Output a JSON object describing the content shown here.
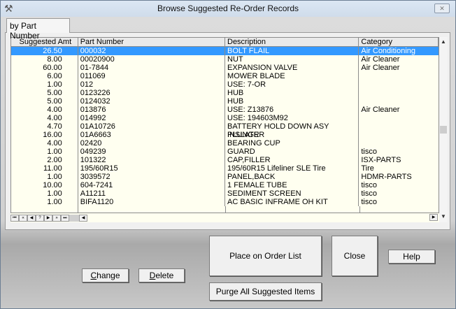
{
  "window": {
    "title": "Browse Suggested Re-Order Records",
    "close_glyph": "✕",
    "app_icon": "tools-icon"
  },
  "tab": {
    "label": "by Part Number"
  },
  "table": {
    "headers": [
      "Suggested Amt",
      "Part Number",
      "Description",
      "Category"
    ],
    "selected_index": 0,
    "rows": [
      [
        "26.50",
        "000032",
        "BOLT FLAIL",
        "Air Conditioning"
      ],
      [
        "8.00",
        "00020900",
        "NUT",
        "Air Cleaner"
      ],
      [
        "60.00",
        "01-7844",
        "EXPANSION VALVE",
        "Air Cleaner"
      ],
      [
        "6.00",
        "011069",
        "MOWER BLADE",
        ""
      ],
      [
        "1.00",
        "012",
        "USE: 7-OR",
        ""
      ],
      [
        "5.00",
        "0123226",
        "HUB",
        ""
      ],
      [
        "5.00",
        "0124032",
        "HUB",
        ""
      ],
      [
        "4.00",
        "013876",
        "USE: Z13876",
        "Air Cleaner"
      ],
      [
        "4.00",
        "014992",
        "USE: 194603M92",
        ""
      ],
      [
        "4.70",
        "01A10726",
        "BATTERY HOLD DOWN ASY INSLATR",
        ""
      ],
      [
        "16.00",
        "01A6663",
        "PLUNGER",
        ""
      ],
      [
        "4.00",
        "02420",
        "BEARING CUP",
        ""
      ],
      [
        "1.00",
        "049239",
        "GUARD",
        "tisco"
      ],
      [
        "2.00",
        "101322",
        "CAP,FILLER",
        "ISX-PARTS"
      ],
      [
        "11.00",
        "195/60R15",
        "195/60R15 Lifeliner SLE Tire",
        "Tire"
      ],
      [
        "1.00",
        "3039572",
        "PANEL,BACK",
        "HDMR-PARTS"
      ],
      [
        "10.00",
        "604-7241",
        "1 FEMALE TUBE",
        "tisco"
      ],
      [
        "1.00",
        "A11211",
        "SEDIMENT SCREEN",
        "tisco"
      ],
      [
        "1.00",
        "BIFA1120",
        "AC BASIC INFRAME OH KIT",
        "tisco"
      ]
    ]
  },
  "navigator": [
    "⏮",
    "«",
    "◀",
    "?",
    "▶",
    "»",
    "⏭"
  ],
  "buttons": {
    "place": "Place on Order List",
    "close": "Close",
    "help": "Help",
    "change_u": "C",
    "change_rest": "hange",
    "delete_u": "D",
    "delete_rest": "elete",
    "purge": "Purge All Suggested Items"
  }
}
